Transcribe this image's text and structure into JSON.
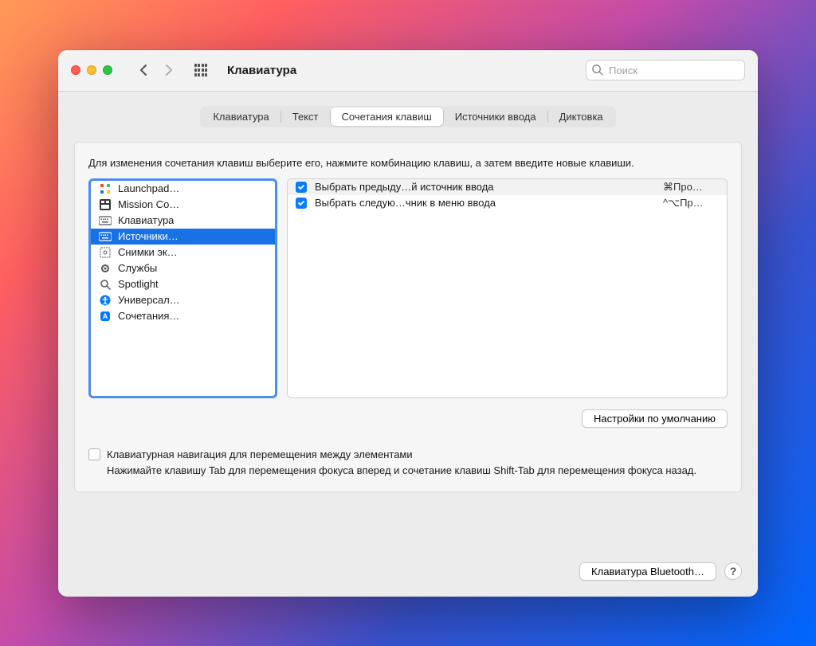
{
  "window": {
    "title": "Клавиатура",
    "search_placeholder": "Поиск"
  },
  "tabs": [
    {
      "label": "Клавиатура",
      "active": false
    },
    {
      "label": "Текст",
      "active": false
    },
    {
      "label": "Сочетания клавиш",
      "active": true
    },
    {
      "label": "Источники ввода",
      "active": false
    },
    {
      "label": "Диктовка",
      "active": false
    }
  ],
  "instruction": "Для изменения сочетания клавиш выберите его, нажмите комбинацию клавиш, а затем введите новые клавиши.",
  "categories": [
    {
      "icon": "launchpad",
      "label": "Launchpad…",
      "selected": false
    },
    {
      "icon": "mission",
      "label": "Mission Co…",
      "selected": false
    },
    {
      "icon": "keyboard",
      "label": "Клавиатура",
      "selected": false
    },
    {
      "icon": "keyboard",
      "label": "Источники…",
      "selected": true
    },
    {
      "icon": "screenshot",
      "label": "Снимки эк…",
      "selected": false
    },
    {
      "icon": "services",
      "label": "Службы",
      "selected": false
    },
    {
      "icon": "spotlight",
      "label": "Spotlight",
      "selected": false
    },
    {
      "icon": "accessibility",
      "label": "Универсал…",
      "selected": false
    },
    {
      "icon": "shortcuts",
      "label": "Сочетания…",
      "selected": false
    }
  ],
  "shortcuts": [
    {
      "checked": true,
      "text": "Выбрать предыду…й источник ввода",
      "key": "⌘Про…",
      "alt": true
    },
    {
      "checked": true,
      "text": "Выбрать следую…чник в меню ввода",
      "key": "^⌥Пр…",
      "alt": false
    }
  ],
  "defaults_button": "Настройки по умолчанию",
  "keyboard_nav": {
    "label": "Клавиатурная навигация для перемещения между элементами",
    "desc": "Нажимайте клавишу Tab для перемещения фокуса вперед и сочетание клавиш Shift-Tab для перемещения фокуса назад."
  },
  "footer": {
    "bluetooth_button": "Клавиатура Bluetooth…",
    "help": "?"
  }
}
